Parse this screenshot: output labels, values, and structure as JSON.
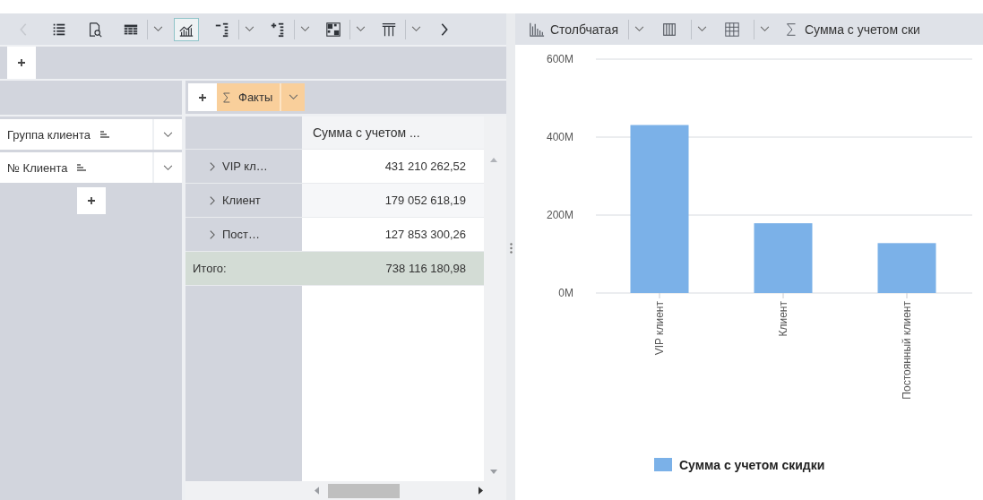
{
  "left_toolbar": {
    "items": [
      {
        "kind": "prev",
        "selected": false,
        "disabled": true
      },
      {
        "kind": "list",
        "selected": false,
        "disabled": false
      },
      {
        "kind": "preview",
        "selected": false,
        "disabled": false
      },
      {
        "kind": "table",
        "selected": false,
        "disabled": false
      },
      {
        "kind": "dropdown",
        "selected": false,
        "disabled": false
      },
      {
        "kind": "chart",
        "selected": true,
        "disabled": false
      },
      {
        "kind": "collapse",
        "selected": false,
        "disabled": false
      },
      {
        "kind": "dropdown",
        "selected": false,
        "disabled": false
      },
      {
        "kind": "expand",
        "selected": false,
        "disabled": false
      },
      {
        "kind": "dropdown",
        "selected": false,
        "disabled": false
      },
      {
        "kind": "layout",
        "selected": false,
        "disabled": false
      },
      {
        "kind": "dropdown",
        "selected": false,
        "disabled": false
      },
      {
        "kind": "columns",
        "selected": false,
        "disabled": false
      },
      {
        "kind": "dropdown",
        "selected": false,
        "disabled": false
      },
      {
        "kind": "next",
        "selected": false,
        "disabled": false
      }
    ]
  },
  "right_toolbar": {
    "items": [
      {
        "kind": "bar-chart",
        "label": "Столбчатая"
      },
      {
        "kind": "dropdown"
      },
      {
        "kind": "columns"
      },
      {
        "kind": "dropdown"
      },
      {
        "kind": "grid"
      },
      {
        "kind": "dropdown"
      },
      {
        "kind": "sigma",
        "label": "Сумма с учетом ски"
      }
    ]
  },
  "facts": {
    "label": "Факты"
  },
  "row_fields": [
    {
      "label": "Группа клиента"
    },
    {
      "label": "№ Клиента"
    }
  ],
  "table": {
    "column_header": "Сумма с учетом ...",
    "rows": [
      {
        "label": "VIP кл…",
        "value": "431 210 262,52",
        "expanded": false
      },
      {
        "label": "Клиент",
        "value": "179 052 618,19",
        "expanded": false
      },
      {
        "label": "Пост…",
        "value": "127 853 300,26",
        "expanded": false
      }
    ],
    "total": {
      "label": "Итого:",
      "value": "738 116 180,98"
    }
  },
  "chart": {
    "chart_data": {
      "type": "bar",
      "categories": [
        "VIP клиент",
        "Клиент",
        "Постоянный клиент"
      ],
      "series": [
        {
          "name": "Сумма с учетом скидки",
          "color": "#7bb1e8",
          "values": [
            431000000,
            179000000,
            128000000
          ]
        }
      ],
      "ylim": [
        0,
        600000000
      ],
      "yticks": [
        {
          "value": 0,
          "label": "0M"
        },
        {
          "value": 200000000,
          "label": "200M"
        },
        {
          "value": 400000000,
          "label": "400M"
        },
        {
          "value": 600000000,
          "label": "600M"
        }
      ]
    }
  }
}
